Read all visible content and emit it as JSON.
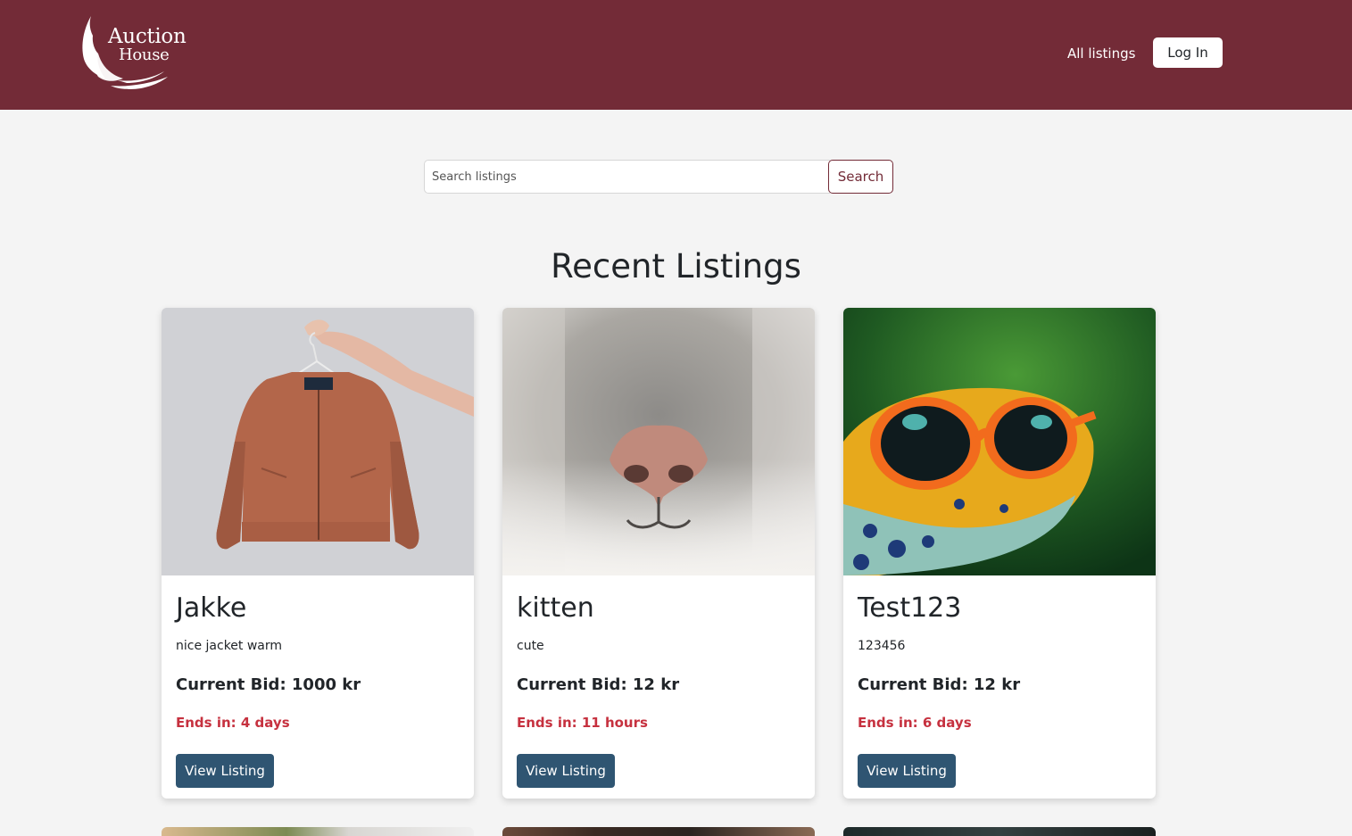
{
  "header": {
    "logo": {
      "line1": "Auction",
      "line2": "House"
    },
    "nav_all_listings": "All listings",
    "login_label": "Log In",
    "brand_color": "#732b37"
  },
  "search": {
    "placeholder": "Search listings",
    "button_label": "Search"
  },
  "section_title": "Recent Listings",
  "listings": [
    {
      "title": "Jakke",
      "description": "nice jacket warm",
      "current_bid": "Current Bid: 1000 kr",
      "ends_in": "Ends in: 4 days",
      "button_label": "View Listing",
      "image_subject": "orange-bomber-jacket-on-hanger"
    },
    {
      "title": "kitten",
      "description": "cute",
      "current_bid": "Current Bid: 12 kr",
      "ends_in": "Ends in: 11 hours",
      "button_label": "View Listing",
      "image_subject": "cat-nose-closeup"
    },
    {
      "title": "Test123",
      "description": "123456",
      "current_bid": "Current Bid: 12 kr",
      "ends_in": "Ends in: 6 days",
      "button_label": "View Listing",
      "image_subject": "frog-with-orange-sunglasses"
    }
  ],
  "colors": {
    "accent_red": "#c6313f",
    "button_blue": "#2f5572",
    "page_bg": "#f4f4f4"
  }
}
